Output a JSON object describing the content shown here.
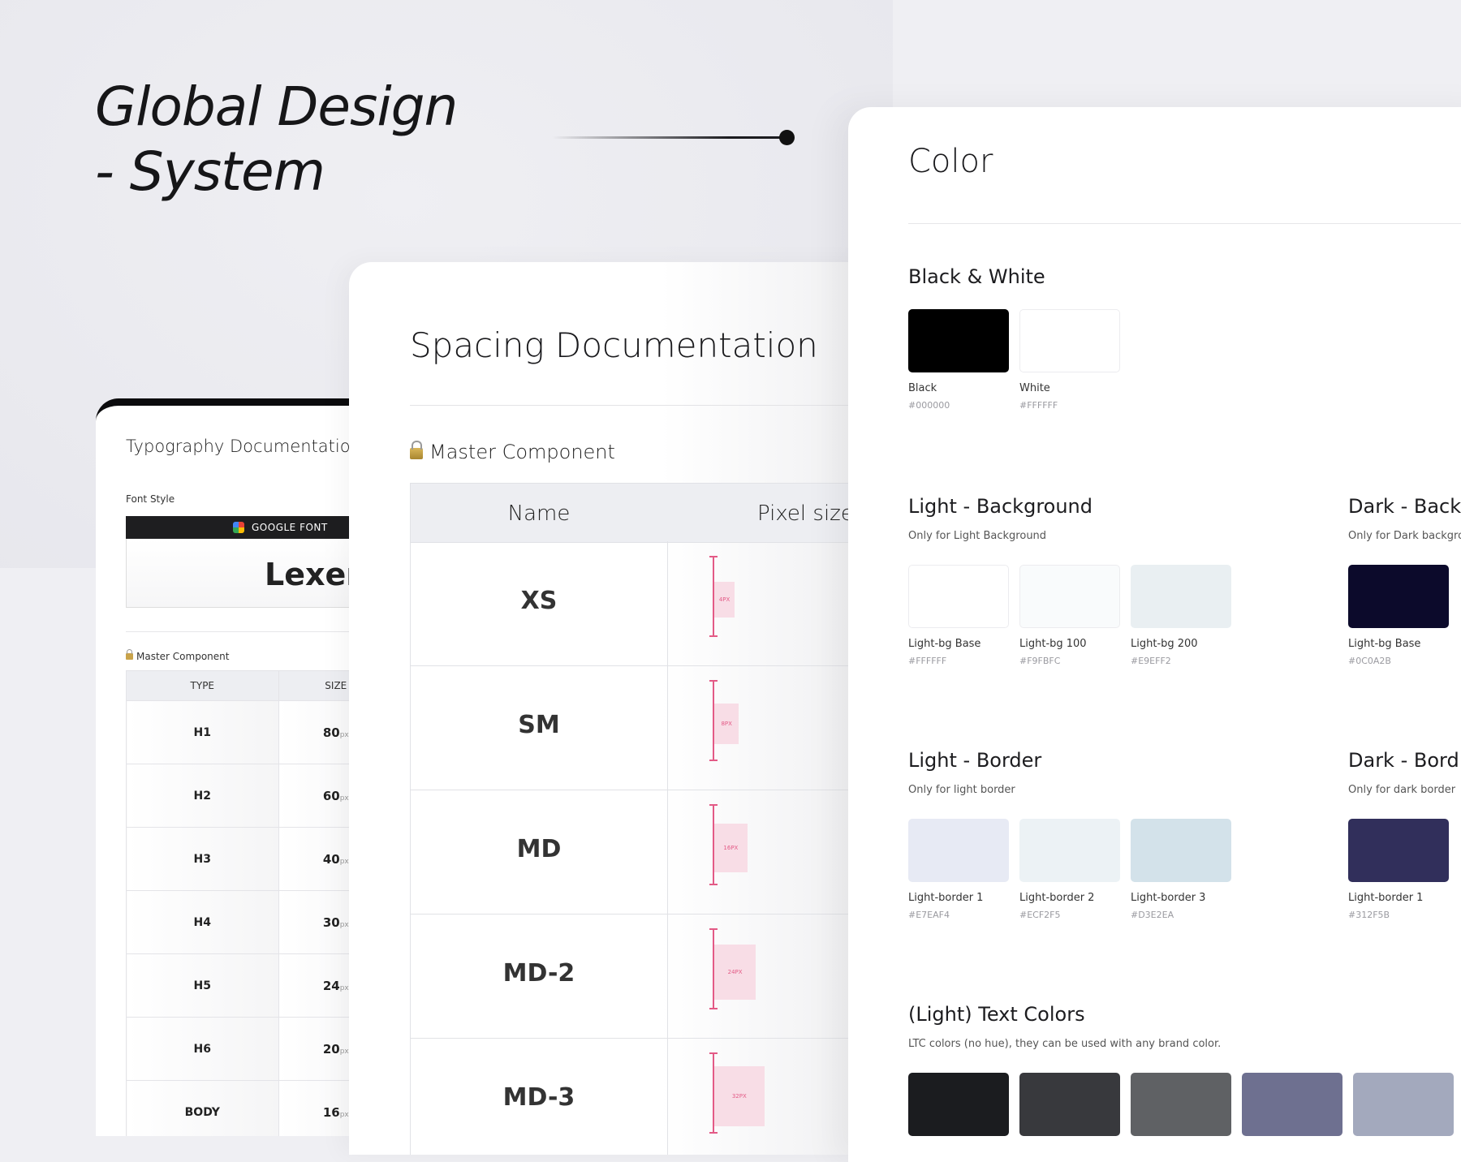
{
  "hero": {
    "title_line1": "Global Design",
    "title_line2": "- System"
  },
  "typography": {
    "title": "Typography Documentation",
    "font_style_label": "Font Style",
    "google_font_label": "GOOGLE FONT",
    "badge": "L",
    "font_name": "Lexen",
    "master_component": "Master Component",
    "col_type": "TYPE",
    "col_size": "SIZE",
    "unit": "px",
    "rows": [
      {
        "type": "H1",
        "size": "80"
      },
      {
        "type": "H2",
        "size": "60"
      },
      {
        "type": "H3",
        "size": "40"
      },
      {
        "type": "H4",
        "size": "30"
      },
      {
        "type": "H5",
        "size": "24"
      },
      {
        "type": "H6",
        "size": "20"
      },
      {
        "type": "BODY",
        "size": "16"
      }
    ]
  },
  "spacing": {
    "title": "Spacing Documentation",
    "master_component": "Master Component",
    "col_name": "Name",
    "col_pixel": "Pixel size",
    "rows": [
      {
        "name": "XS",
        "label": "4PX",
        "size": 4
      },
      {
        "name": "SM",
        "label": "8PX",
        "size": 8
      },
      {
        "name": "MD",
        "label": "16PX",
        "size": 16
      },
      {
        "name": "MD-2",
        "label": "24PX",
        "size": 24
      },
      {
        "name": "MD-3",
        "label": "32PX",
        "size": 32
      }
    ]
  },
  "color": {
    "title": "Color",
    "black_white": {
      "heading": "Black & White",
      "swatches": [
        {
          "name": "Black",
          "hex": "#000000"
        },
        {
          "name": "White",
          "hex": "#FFFFFF"
        }
      ]
    },
    "light_bg": {
      "heading": "Light - Background",
      "sub": "Only for Light Background",
      "swatches": [
        {
          "name": "Light-bg Base",
          "hex": "#FFFFFF"
        },
        {
          "name": "Light-bg 100",
          "hex": "#F9FBFC"
        },
        {
          "name": "Light-bg 200",
          "hex": "#E9EFF2"
        }
      ]
    },
    "dark_bg": {
      "heading": "Dark - Back",
      "sub": "Only for Dark backgrou",
      "swatches": [
        {
          "name": "Light-bg Base",
          "hex": "#0C0A2B"
        }
      ]
    },
    "light_border": {
      "heading": "Light - Border",
      "sub": "Only for light border",
      "swatches": [
        {
          "name": "Light-border 1",
          "hex": "#E7EAF4"
        },
        {
          "name": "Light-border 2",
          "hex": "#ECF2F5"
        },
        {
          "name": "Light-border 3",
          "hex": "#D3E2EA"
        }
      ]
    },
    "dark_border": {
      "heading": "Dark - Bord",
      "sub": "Only for dark border",
      "swatches": [
        {
          "name": "Light-border 1",
          "hex": "#312F5B"
        }
      ]
    },
    "text_colors": {
      "heading": "(Light) Text Colors",
      "sub": "LTC colors (no hue), they can be used with any brand color.",
      "swatch_colors": [
        "#1B1C1F",
        "#38393D",
        "#5F6164",
        "#6E7090",
        "#A3A9BD"
      ]
    }
  }
}
